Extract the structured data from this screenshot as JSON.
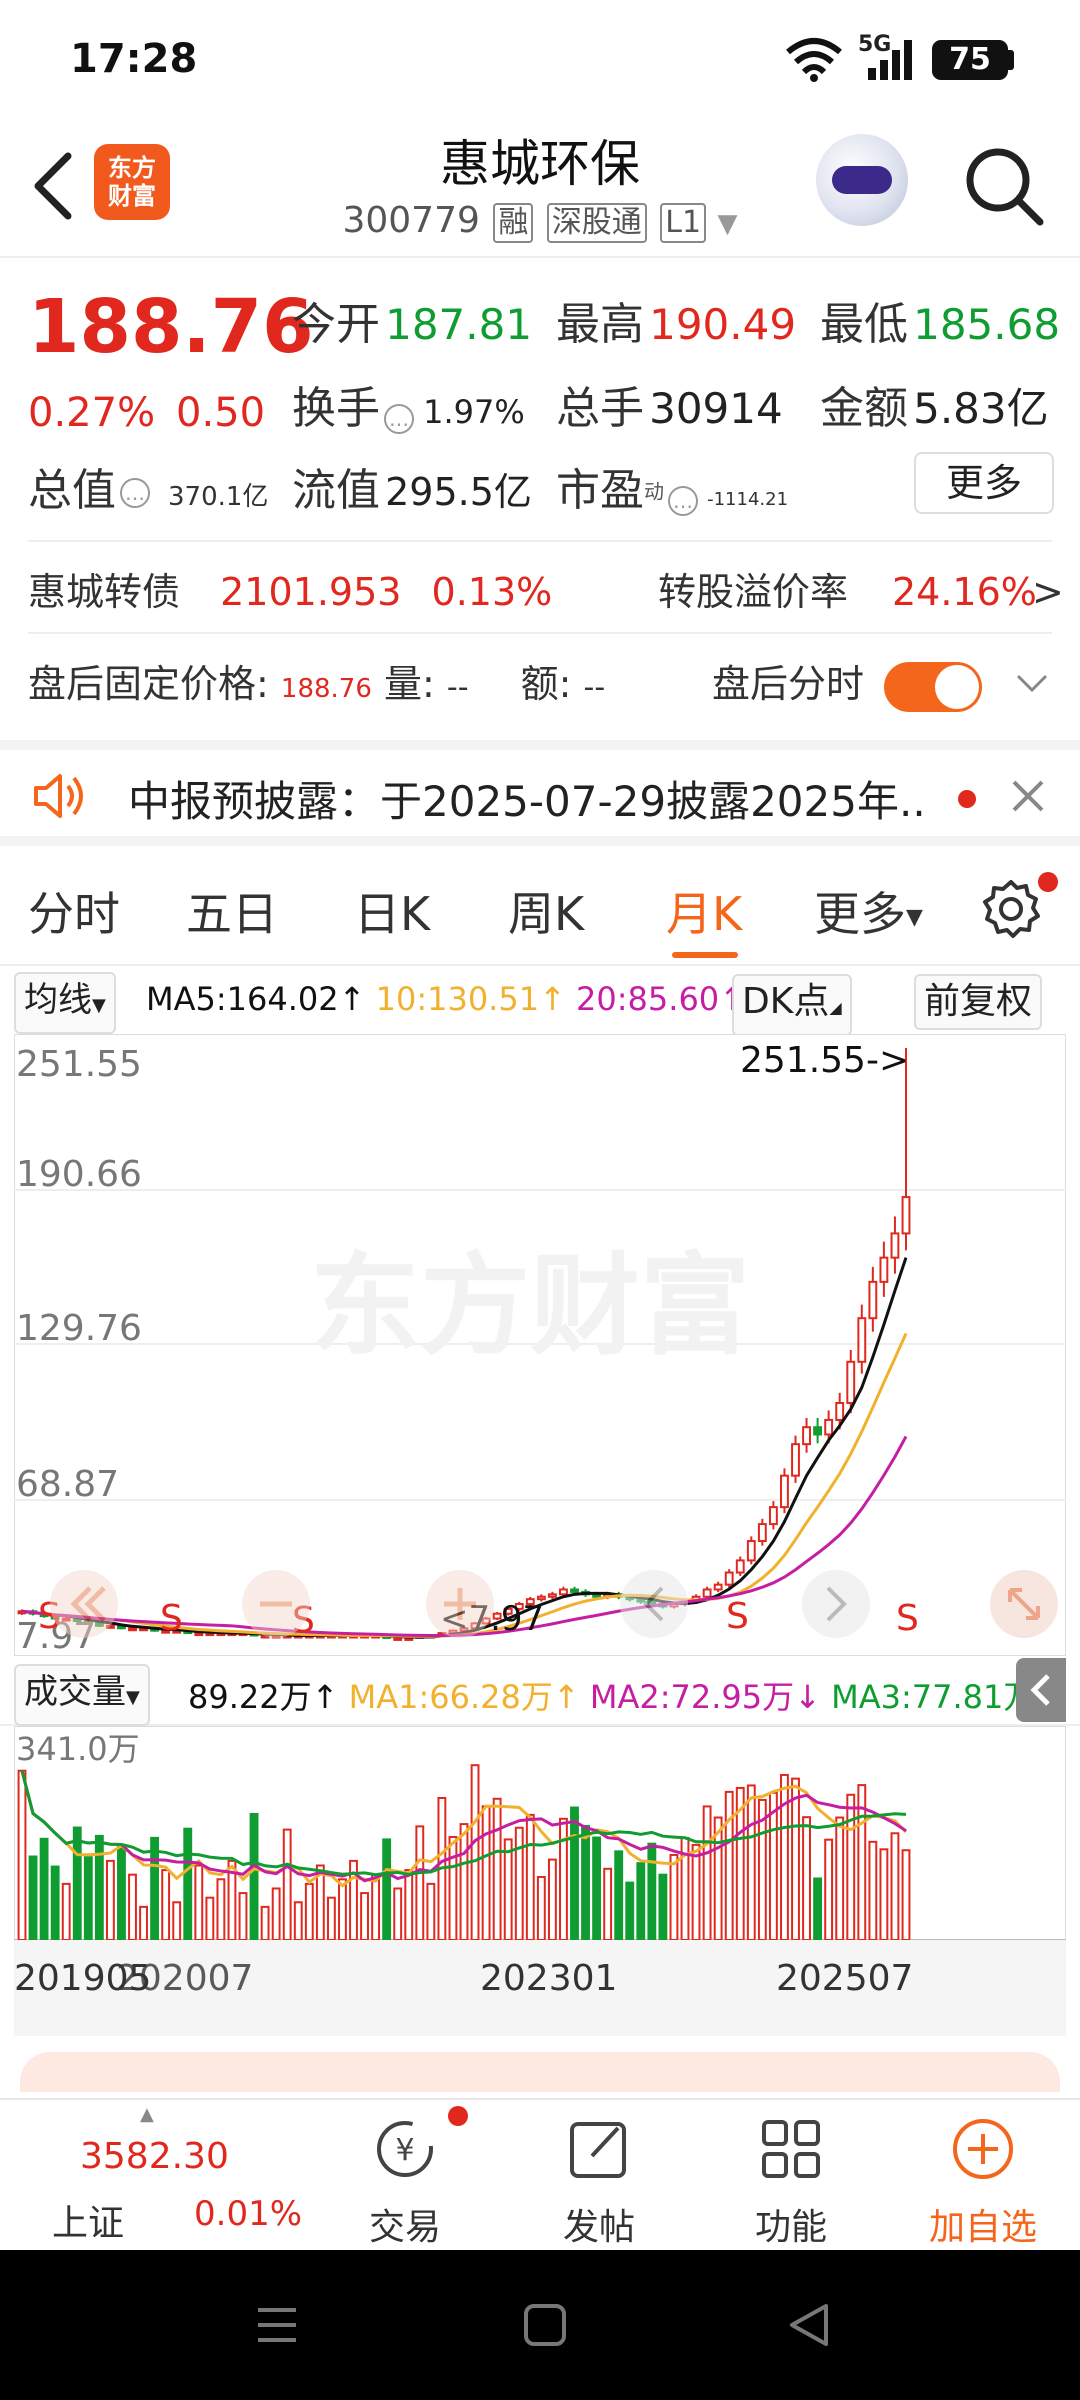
{
  "status_bar": {
    "time": "17:28",
    "battery": "75",
    "network": "5G"
  },
  "header": {
    "logo_line1": "东方",
    "logo_line2": "财富",
    "stock_name": "惠城环保",
    "stock_code": "300779",
    "tags": [
      "融",
      "深股通",
      "L1"
    ]
  },
  "quote": {
    "price": "188.76",
    "change_pct": "0.27%",
    "change_amt": "0.50",
    "open_label": "今开",
    "open_value": "187.81",
    "high_label": "最高",
    "high_value": "190.49",
    "low_label": "最低",
    "low_value": "185.68",
    "turnover_label": "换手",
    "turnover_value": "1.97%",
    "volume_label": "总手",
    "volume_value": "30914",
    "amount_label": "金额",
    "amount_value": "5.83亿",
    "total_cap_label": "总值",
    "total_cap_value": "370.1亿",
    "float_cap_label": "流值",
    "float_cap_value": "295.5亿",
    "pe_label": "市盈",
    "pe_sup": "动",
    "pe_value": "-1114.21",
    "more_label": "更多"
  },
  "bond": {
    "name": "惠城转债",
    "price": "2101.953",
    "change": "0.13%",
    "premium_label": "转股溢价率",
    "premium_value": "24.16%",
    "arrow": ">"
  },
  "after_hours": {
    "label": "盘后固定价格:",
    "price": "188.76",
    "vol_label": "量:",
    "vol_value": "--",
    "amt_label": "额:",
    "amt_value": "--",
    "toggle_label": "盘后分时",
    "toggle_on": true
  },
  "notice": {
    "text": "中报预披露：于2025-07-29披露2025年..."
  },
  "tabs": [
    {
      "label": "分时"
    },
    {
      "label": "五日"
    },
    {
      "label": "日K"
    },
    {
      "label": "周K"
    },
    {
      "label": "月K",
      "active": true
    },
    {
      "label": "更多"
    }
  ],
  "ma_bar": {
    "selector": "均线",
    "ma5": "MA5:164.02↑",
    "ma10": "10:130.51↑",
    "ma20": "20:85.60↑",
    "dk_label": "DK点",
    "adjust_label": "前复权"
  },
  "price_chart": {
    "y_labels": [
      "251.55",
      "190.66",
      "129.76",
      "68.87",
      "7.97"
    ],
    "max_marker": "251.55->",
    "min_marker": "<7.97",
    "watermark": "东方财富",
    "signal_label": "S"
  },
  "volume_bar": {
    "selector": "成交量",
    "vol": "89.22万↑",
    "ma1": "MA1:66.28万↑",
    "ma2": "MA2:72.95万↓",
    "ma3": "MA3:77.81万↑",
    "y_max": "341.0万"
  },
  "x_axis": [
    "201905",
    "202007",
    "202301",
    "202507"
  ],
  "chart_data": {
    "type": "candlestick",
    "period": "monthly",
    "ylim": [
      7.97,
      251.55
    ],
    "max_price": 251.55,
    "min_price": 7.97,
    "close_prices": [
      19,
      18,
      17,
      16,
      16,
      15,
      14,
      13,
      13,
      12,
      12,
      12,
      11,
      11,
      11,
      10,
      10,
      10,
      10,
      10,
      10,
      9,
      9,
      9,
      9,
      9,
      9,
      9,
      9,
      9,
      9,
      9,
      9,
      8,
      8,
      8,
      9,
      9,
      10,
      11,
      12,
      14,
      16,
      18,
      20,
      22,
      24,
      25,
      26,
      28,
      27,
      26,
      25,
      26,
      25,
      24,
      23,
      22,
      21,
      22,
      23,
      25,
      28,
      30,
      35,
      40,
      48,
      55,
      62,
      75,
      88,
      95,
      92,
      98,
      105,
      122,
      140,
      155,
      165,
      175,
      190
    ]
  },
  "bottom_nav": {
    "index_value": "3582.30",
    "index_name": "上证",
    "index_pct": "0.01%",
    "items": [
      {
        "label": "交易",
        "icon": "trade-icon"
      },
      {
        "label": "发帖",
        "icon": "post-icon"
      },
      {
        "label": "功能",
        "icon": "grid-icon"
      },
      {
        "label": "加自选",
        "icon": "add-circle-icon"
      }
    ]
  },
  "colors": {
    "up": "#e0281e",
    "down": "#0f9d32",
    "accent": "#f5661d",
    "ma5": "#111111",
    "ma10": "#f1b12e",
    "ma20": "#c51ea3"
  }
}
